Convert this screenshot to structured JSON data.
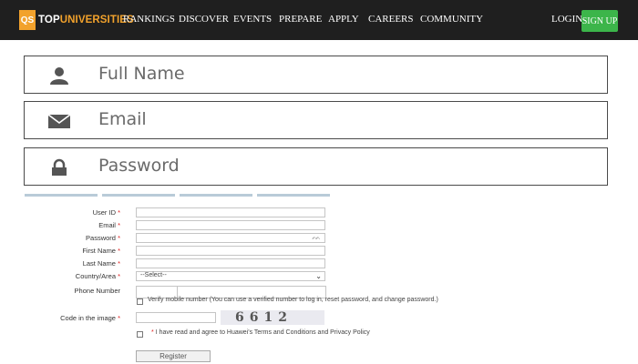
{
  "brand": {
    "badge": "QS",
    "text_part1": "TOP",
    "text_part2": "UNIVERSITIES",
    "accent_color": "#f2a22c"
  },
  "nav": {
    "items": [
      "RANKINGS",
      "DISCOVER",
      "EVENTS",
      "PREPARE",
      "APPLY",
      "CAREERS",
      "COMMUNITY"
    ],
    "login": "LOGIN",
    "signup": "SIGN UP",
    "signup_color": "#3cb54a"
  },
  "big_fields": [
    {
      "label": "Full Name",
      "icon": "user-icon"
    },
    {
      "label": "Email",
      "icon": "envelope-icon"
    },
    {
      "label": "Password",
      "icon": "lock-icon"
    }
  ],
  "form": {
    "rows": [
      {
        "label": "User ID",
        "required": true
      },
      {
        "label": "Email",
        "required": true
      },
      {
        "label": "Password",
        "required": true
      },
      {
        "label": "First Name",
        "required": true
      },
      {
        "label": "Last Name",
        "required": true
      },
      {
        "label": "Country/Area",
        "required": true
      },
      {
        "label": "Phone Number",
        "required": false
      }
    ],
    "required_mark": "*",
    "country_select_value": "--Select--",
    "verify_text": "Verify mobile number (You can use a verified number to log in, reset password, and change password.)",
    "captcha_label": "Code in the image",
    "captcha_value": "6612",
    "agree_text": "I have read and agree to Huawei's Terms and Conditions and Privacy Policy",
    "register_label": "Register"
  }
}
